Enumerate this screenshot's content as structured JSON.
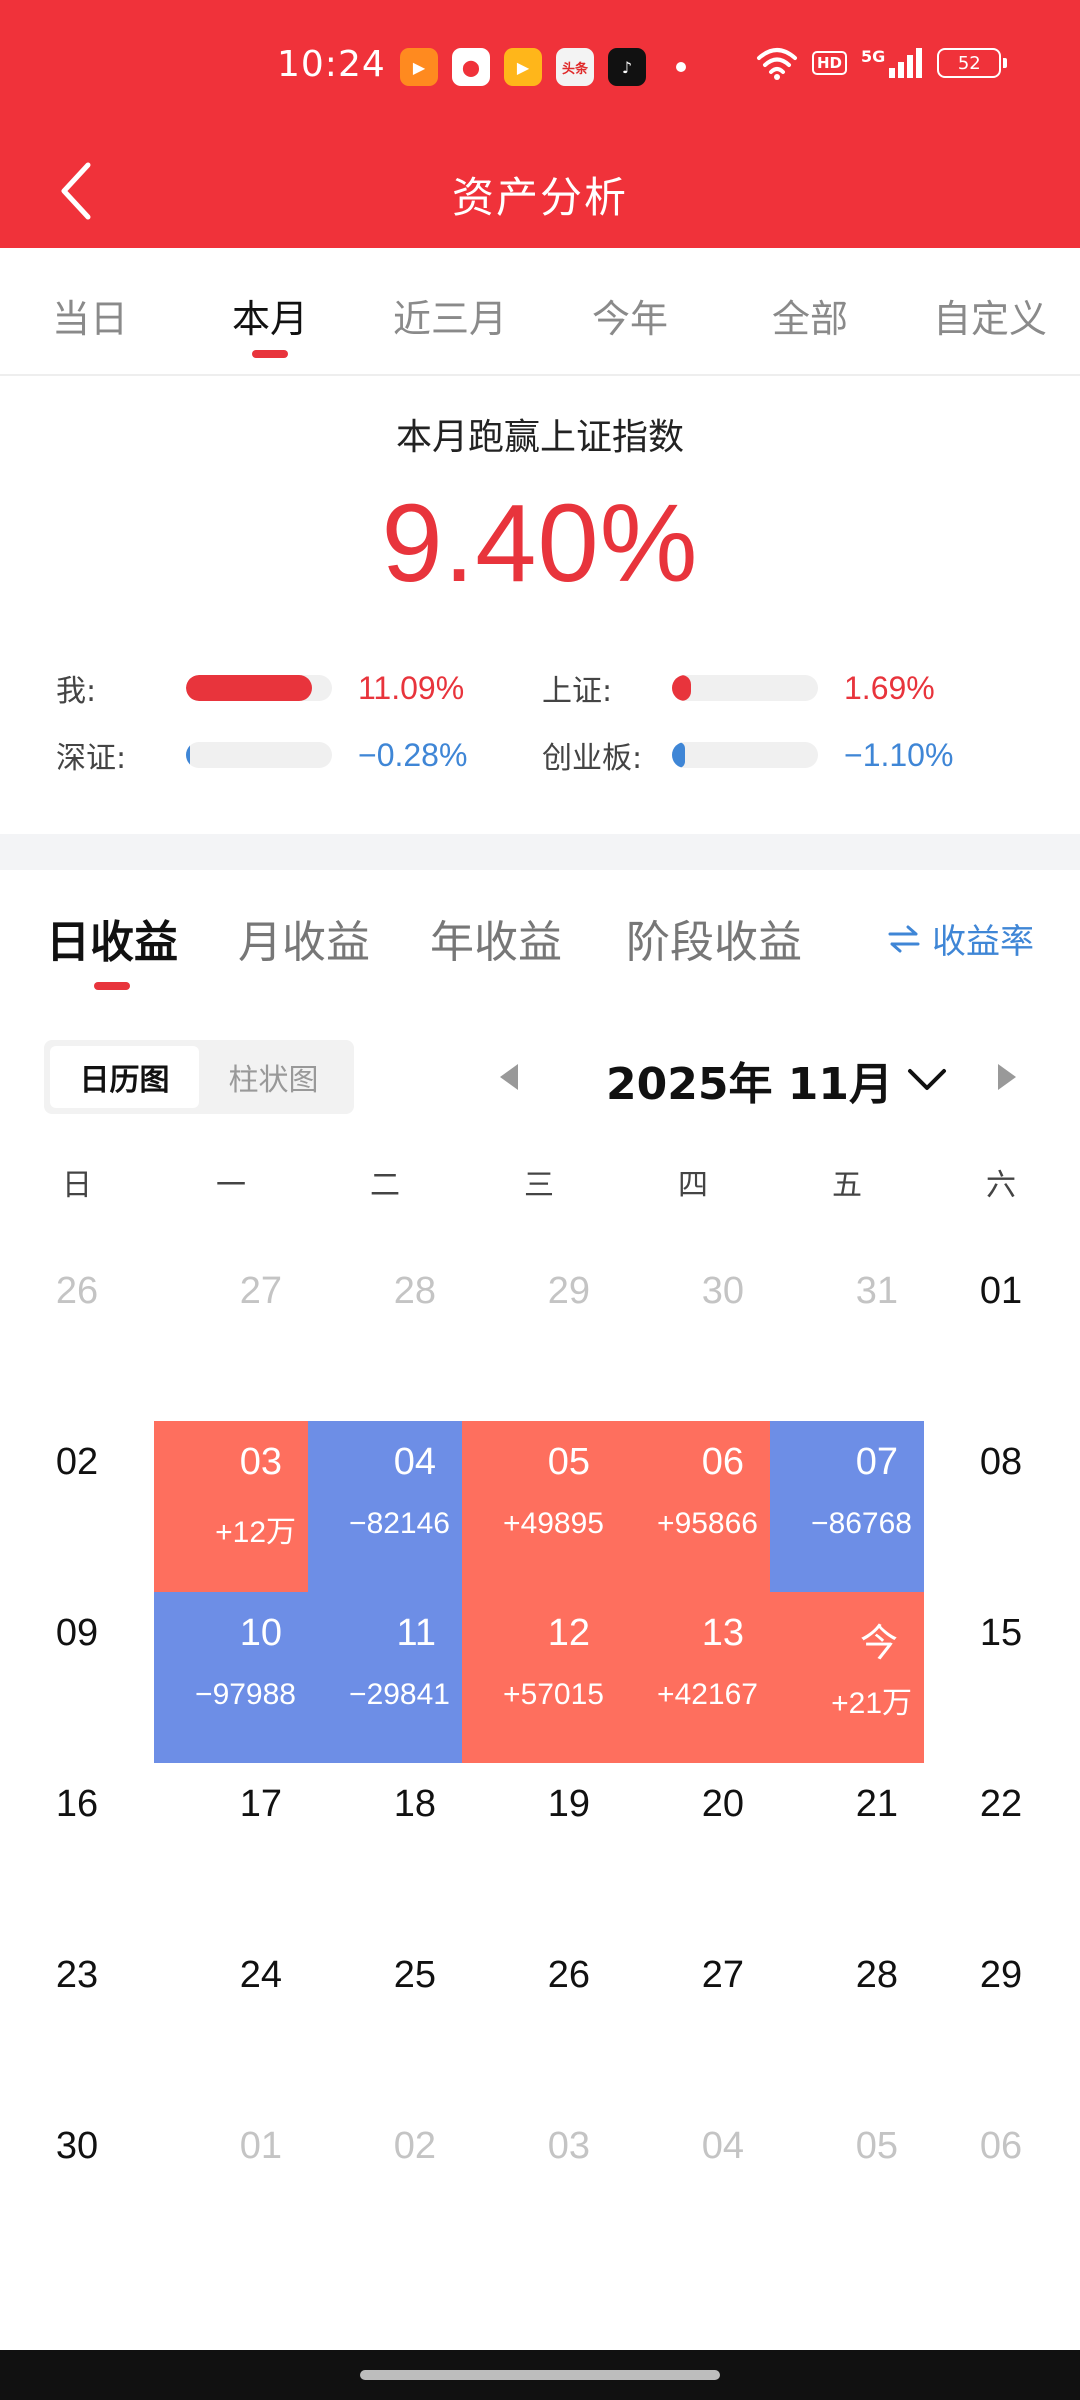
{
  "status_bar": {
    "time": "10:24",
    "network": "5G",
    "hd": "HD",
    "battery": "52",
    "app_icons": [
      "kuaishou-icon",
      "map-pin-icon",
      "kuaishou-lite-icon",
      "toutiao-icon",
      "tiktok-icon"
    ],
    "toutiao_text": "头条"
  },
  "header": {
    "title": "资产分析"
  },
  "period_tabs": [
    {
      "label": "当日",
      "active": false
    },
    {
      "label": "本月",
      "active": true
    },
    {
      "label": "近三月",
      "active": false
    },
    {
      "label": "今年",
      "active": false
    },
    {
      "label": "全部",
      "active": false
    },
    {
      "label": "自定义",
      "active": false
    }
  ],
  "summary": {
    "headline": "本月跑赢上证指数",
    "excess_return": "9.40%",
    "comparisons": [
      {
        "label": "我:",
        "value": "11.09%",
        "tone": "red",
        "fill_fraction": 0.86
      },
      {
        "label": "上证:",
        "value": "1.69%",
        "tone": "red",
        "fill_fraction": 0.13
      },
      {
        "label": "深证:",
        "value": "−0.28%",
        "tone": "blue",
        "fill_fraction": 0.03
      },
      {
        "label": "创业板:",
        "value": "−1.10%",
        "tone": "blue",
        "fill_fraction": 0.09
      }
    ]
  },
  "earnings_tabs": [
    {
      "label": "日收益",
      "active": true
    },
    {
      "label": "月收益",
      "active": false
    },
    {
      "label": "年收益",
      "active": false
    },
    {
      "label": "阶段收益",
      "active": false
    }
  ],
  "rate_toggle": {
    "label": "收益率"
  },
  "view_switch": [
    {
      "label": "日历图",
      "active": true
    },
    {
      "label": "柱状图",
      "active": false
    }
  ],
  "month_nav": {
    "month": "2025年 11月"
  },
  "weekdays": [
    "日",
    "一",
    "二",
    "三",
    "四",
    "五",
    "六"
  ],
  "calendar": [
    [
      {
        "day": "26",
        "muted": true
      },
      {
        "day": "27",
        "muted": true
      },
      {
        "day": "28",
        "muted": true
      },
      {
        "day": "29",
        "muted": true
      },
      {
        "day": "30",
        "muted": true
      },
      {
        "day": "31",
        "muted": true
      },
      {
        "day": "01"
      }
    ],
    [
      {
        "day": "02"
      },
      {
        "day": "03",
        "value": "+12万",
        "tone": "up"
      },
      {
        "day": "04",
        "value": "−82146",
        "tone": "down"
      },
      {
        "day": "05",
        "value": "+49895",
        "tone": "up"
      },
      {
        "day": "06",
        "value": "+95866",
        "tone": "up"
      },
      {
        "day": "07",
        "value": "−86768",
        "tone": "down"
      },
      {
        "day": "08"
      }
    ],
    [
      {
        "day": "09"
      },
      {
        "day": "10",
        "value": "−97988",
        "tone": "down"
      },
      {
        "day": "11",
        "value": "−29841",
        "tone": "down"
      },
      {
        "day": "12",
        "value": "+57015",
        "tone": "up"
      },
      {
        "day": "13",
        "value": "+42167",
        "tone": "up"
      },
      {
        "day": "今",
        "value": "+21万",
        "tone": "up"
      },
      {
        "day": "15"
      }
    ],
    [
      {
        "day": "16"
      },
      {
        "day": "17"
      },
      {
        "day": "18"
      },
      {
        "day": "19"
      },
      {
        "day": "20"
      },
      {
        "day": "21"
      },
      {
        "day": "22"
      }
    ],
    [
      {
        "day": "23"
      },
      {
        "day": "24"
      },
      {
        "day": "25"
      },
      {
        "day": "26"
      },
      {
        "day": "27"
      },
      {
        "day": "28"
      },
      {
        "day": "29"
      }
    ],
    [
      {
        "day": "30"
      },
      {
        "day": "01",
        "muted": true
      },
      {
        "day": "02",
        "muted": true
      },
      {
        "day": "03",
        "muted": true
      },
      {
        "day": "04",
        "muted": true
      },
      {
        "day": "05",
        "muted": true
      },
      {
        "day": "06",
        "muted": true
      }
    ]
  ],
  "colors": {
    "brand_red": "#f0323a",
    "gain": "#fe6f5e",
    "loss": "#6d8ee6",
    "accent_blue": "#3f86d6"
  }
}
